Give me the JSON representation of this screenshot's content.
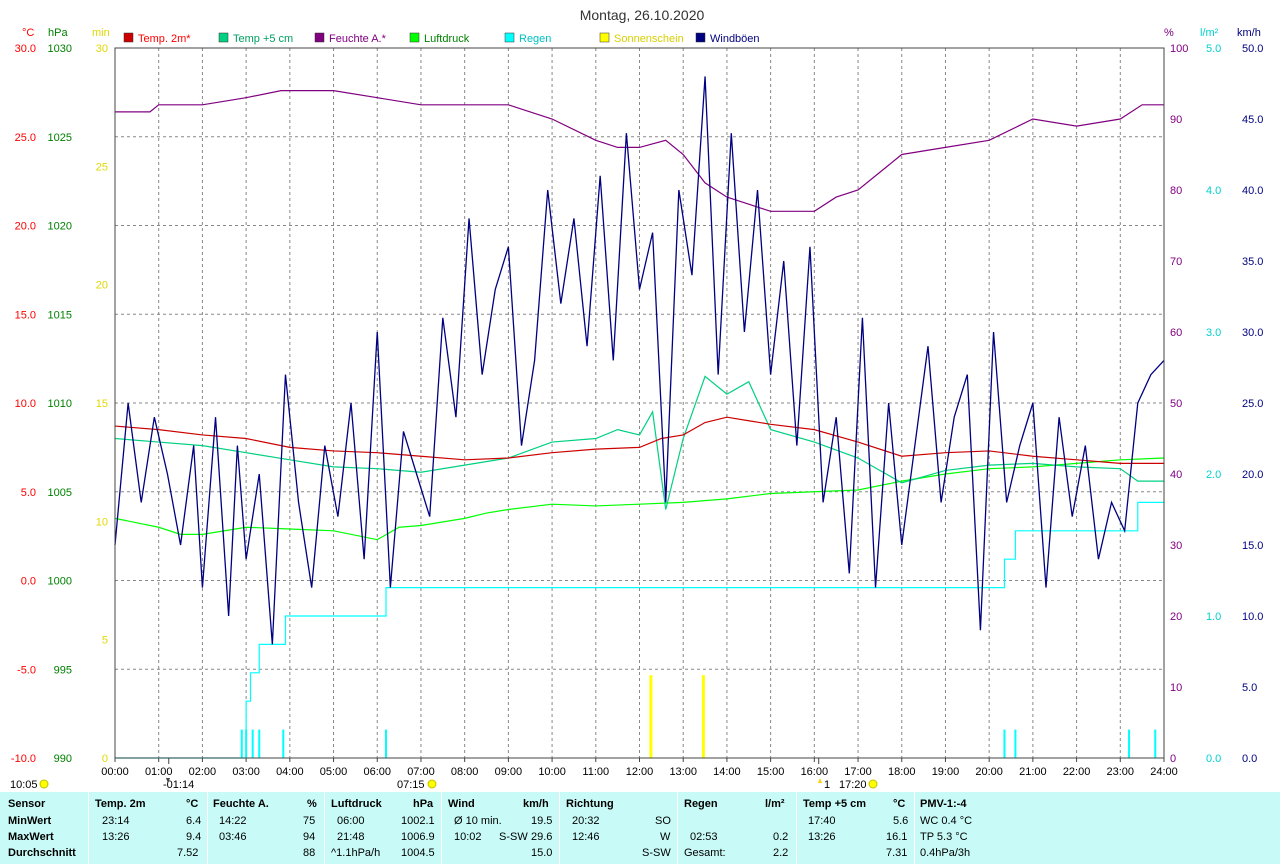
{
  "chart_data": {
    "type": "line",
    "title": "Montag, 26.10.2020",
    "x_ticks": [
      "00:00",
      "01:00",
      "02:00",
      "03:00",
      "04:00",
      "05:00",
      "06:00",
      "07:00",
      "08:00",
      "09:00",
      "10:00",
      "11:00",
      "12:00",
      "13:00",
      "14:00",
      "15:00",
      "16:00",
      "17:00",
      "18:00",
      "19:00",
      "20:00",
      "21:00",
      "22:00",
      "23:00",
      "24:00"
    ],
    "x_range_h": [
      0,
      24
    ],
    "grid": true,
    "legend_position": "top",
    "axes": {
      "temp": {
        "unit": "°C",
        "range": [
          -10,
          30
        ],
        "ticks": [
          "30.0",
          "25.0",
          "20.0",
          "15.0",
          "10.0",
          "5.0",
          "0.0",
          "-5.0",
          "-10.0"
        ],
        "color": "#ff0000"
      },
      "press": {
        "unit": "hPa",
        "range": [
          990,
          1030
        ],
        "ticks": [
          "1030",
          "1025",
          "1020",
          "1015",
          "1010",
          "1005",
          "1000",
          "995",
          "990"
        ],
        "color": "#008000"
      },
      "sun": {
        "unit": "min",
        "range": [
          0,
          30
        ],
        "ticks": [
          "30",
          "25",
          "20",
          "15",
          "10",
          "5",
          "0"
        ],
        "color": "#ffff00"
      },
      "hum": {
        "unit": "%",
        "range": [
          0,
          100
        ],
        "ticks": [
          "100",
          "90",
          "80",
          "70",
          "60",
          "50",
          "40",
          "30",
          "20",
          "10",
          "0"
        ],
        "color": "#800080"
      },
      "rain": {
        "unit": "l/m²",
        "range": [
          0,
          5
        ],
        "ticks": [
          "5.0",
          "4.0",
          "3.0",
          "2.0",
          "1.0",
          "0.0"
        ],
        "color": "#00ffff"
      },
      "wind": {
        "unit": "km/h",
        "range": [
          0,
          50
        ],
        "ticks": [
          "50.0",
          "45.0",
          "40.0",
          "35.0",
          "30.0",
          "25.0",
          "20.0",
          "15.0",
          "10.0",
          "5.0",
          "0.0"
        ],
        "color": "#000080"
      }
    },
    "legend": [
      {
        "name": "Temp. 2m*",
        "color": "#cc0000",
        "text_color": "#ff0000"
      },
      {
        "name": "Temp +5 cm",
        "color": "#00d080",
        "text_color": "#00a060"
      },
      {
        "name": "Feuchte A.*",
        "color": "#800080",
        "text_color": "#800080"
      },
      {
        "name": "Luftdruck",
        "color": "#00ff00",
        "text_color": "#008000"
      },
      {
        "name": "Regen",
        "color": "#00ffff",
        "text_color": "#00c0c0"
      },
      {
        "name": "Sonnenschein",
        "color": "#ffff00",
        "text_color": "#d8d000"
      },
      {
        "name": "Windböen",
        "color": "#000080",
        "text_color": "#000080"
      }
    ],
    "series": [
      {
        "name": "Temp. 2m*",
        "axis": "temp",
        "color": "#cc0000",
        "x": [
          0,
          1,
          2,
          3,
          4,
          5,
          6,
          7,
          8,
          9,
          10,
          11,
          12,
          12.5,
          13,
          13.5,
          14,
          14.5,
          15,
          16,
          17,
          18,
          19,
          20,
          21,
          22,
          23,
          24
        ],
        "y": [
          8.7,
          8.5,
          8.2,
          8.0,
          7.5,
          7.3,
          7.2,
          7.0,
          6.8,
          6.9,
          7.2,
          7.4,
          7.5,
          8.0,
          8.2,
          8.9,
          9.2,
          9.0,
          8.8,
          8.5,
          7.8,
          7.0,
          7.2,
          7.3,
          7.0,
          6.8,
          6.6,
          6.6
        ]
      },
      {
        "name": "Temp +5 cm",
        "axis": "temp",
        "color": "#00d080",
        "x": [
          0,
          1,
          2,
          3,
          4,
          5,
          6,
          7,
          8,
          9,
          10,
          11,
          11.5,
          12,
          12.3,
          12.6,
          13,
          13.5,
          14,
          14.5,
          15,
          16,
          17,
          18,
          19,
          20,
          21,
          22,
          23,
          23.4,
          24
        ],
        "y": [
          8.0,
          7.8,
          7.6,
          7.2,
          6.8,
          6.4,
          6.3,
          6.1,
          6.5,
          6.9,
          7.8,
          8.0,
          8.5,
          8.2,
          9.5,
          4.0,
          8.0,
          11.5,
          10.5,
          11.2,
          8.5,
          7.8,
          6.9,
          5.5,
          6.2,
          6.5,
          6.6,
          6.4,
          6.3,
          5.6,
          5.6
        ]
      },
      {
        "name": "Feuchte A.*",
        "axis": "hum",
        "color": "#800080",
        "x": [
          0,
          0.8,
          1,
          2,
          3,
          3.8,
          4.5,
          5,
          6,
          7,
          8,
          9,
          10,
          11,
          11.5,
          12,
          12.6,
          13,
          13.5,
          14,
          14.5,
          15,
          16,
          16.5,
          17,
          18,
          19,
          20,
          21,
          22,
          23,
          23.5,
          24
        ],
        "y": [
          91,
          91,
          92,
          92,
          93,
          94,
          94,
          94,
          93,
          92,
          92,
          92,
          90,
          87,
          86,
          86,
          87,
          85,
          81,
          79,
          78,
          77,
          77,
          79,
          80,
          85,
          86,
          87,
          90,
          89,
          90,
          92,
          92
        ]
      },
      {
        "name": "Luftdruck",
        "axis": "press",
        "color": "#00ff00",
        "x": [
          0,
          1,
          1.5,
          2,
          3,
          4,
          5,
          6,
          6.5,
          7,
          8,
          8.5,
          9,
          10,
          11,
          12,
          13,
          14,
          15,
          16,
          17,
          18,
          19,
          20,
          21,
          22,
          23,
          24
        ],
        "y": [
          1003.5,
          1003.0,
          1002.6,
          1002.6,
          1003.0,
          1002.9,
          1002.8,
          1002.3,
          1003.0,
          1003.1,
          1003.5,
          1003.8,
          1004.0,
          1004.3,
          1004.2,
          1004.3,
          1004.4,
          1004.6,
          1004.9,
          1005.0,
          1005.1,
          1005.6,
          1006.0,
          1006.3,
          1006.4,
          1006.6,
          1006.8,
          1006.9
        ]
      },
      {
        "name": "Regen",
        "axis": "rain",
        "color": "#00ffff",
        "x": [
          0,
          2.9,
          3.0,
          3.1,
          3.3,
          3.8,
          3.9,
          4.5,
          5,
          6,
          6.2,
          7,
          8,
          9,
          10,
          11,
          12,
          13,
          14,
          15,
          16,
          17,
          18,
          19,
          20,
          20.35,
          20.6,
          21,
          22,
          23,
          23.4,
          24
        ],
        "y": [
          0,
          0,
          0.4,
          0.6,
          0.8,
          0.8,
          1.0,
          1.0,
          1.0,
          1.0,
          1.2,
          1.2,
          1.2,
          1.2,
          1.2,
          1.2,
          1.2,
          1.2,
          1.2,
          1.2,
          1.2,
          1.2,
          1.2,
          1.2,
          1.2,
          1.4,
          1.6,
          1.6,
          1.6,
          1.6,
          1.8,
          1.8
        ]
      },
      {
        "name": "Windböen",
        "axis": "wind",
        "color": "#000080",
        "x": [
          0,
          0.3,
          0.6,
          0.9,
          1.2,
          1.5,
          1.8,
          2.0,
          2.3,
          2.6,
          2.8,
          3.0,
          3.3,
          3.6,
          3.9,
          4.2,
          4.5,
          4.8,
          5.1,
          5.4,
          5.7,
          6.0,
          6.3,
          6.6,
          6.9,
          7.2,
          7.5,
          7.8,
          8.1,
          8.4,
          8.7,
          9.0,
          9.3,
          9.6,
          9.9,
          10.2,
          10.5,
          10.8,
          11.1,
          11.4,
          11.7,
          12.0,
          12.3,
          12.6,
          12.9,
          13.2,
          13.5,
          13.8,
          14.1,
          14.4,
          14.7,
          15.0,
          15.3,
          15.6,
          15.9,
          16.2,
          16.5,
          16.8,
          17.1,
          17.4,
          17.7,
          18.0,
          18.3,
          18.6,
          18.9,
          19.2,
          19.5,
          19.8,
          20.1,
          20.4,
          20.7,
          21.0,
          21.3,
          21.6,
          21.9,
          22.2,
          22.5,
          22.8,
          23.1,
          23.4,
          23.7,
          24.0
        ],
        "y": [
          15,
          25,
          18,
          24,
          20,
          15,
          22,
          12,
          24,
          10,
          22,
          14,
          20,
          8,
          27,
          18,
          12,
          22,
          17,
          25,
          14,
          30,
          12,
          23,
          20,
          17,
          31,
          24,
          38,
          27,
          33,
          36,
          22,
          28,
          40,
          32,
          38,
          29,
          41,
          28,
          44,
          33,
          37,
          18,
          40,
          34,
          48,
          27,
          44,
          30,
          40,
          27,
          35,
          22,
          36,
          18,
          24,
          13,
          31,
          12,
          25,
          15,
          22,
          29,
          18,
          24,
          27,
          9,
          30,
          18,
          22,
          25,
          12,
          24,
          17,
          22,
          14,
          18,
          16,
          25,
          27,
          28
        ]
      }
    ],
    "sun_bars": [
      {
        "x": 12.25,
        "value": 3.5
      },
      {
        "x": 13.45,
        "value": 3.5
      }
    ],
    "rain_bars": [
      {
        "x": 2.9,
        "value": 0.2
      },
      {
        "x": 3.0,
        "value": 0.2
      },
      {
        "x": 3.15,
        "value": 0.2
      },
      {
        "x": 3.3,
        "value": 0.2
      },
      {
        "x": 3.85,
        "value": 0.2
      },
      {
        "x": 6.2,
        "value": 0.2
      },
      {
        "x": 20.35,
        "value": 0.2
      },
      {
        "x": 20.6,
        "value": 0.2
      },
      {
        "x": 23.2,
        "value": 0.2
      },
      {
        "x": 23.8,
        "value": 0.2
      }
    ],
    "annotations": {
      "sunrise": "07:15",
      "sunset": "17:20",
      "time_left": "10:05",
      "marker_1": "-01:14",
      "marker_2": "1"
    }
  },
  "summary": {
    "headers": {
      "sensor": "Sensor",
      "temp2m": "Temp. 2m",
      "temp2m_unit": "°C",
      "hum": "Feuchte A.",
      "hum_unit": "%",
      "press": "Luftdruck",
      "press_unit": "hPa",
      "wind": "Wind",
      "wind_unit": "km/h",
      "dir": "Richtung",
      "rain": "Regen",
      "rain_unit": "l/m²",
      "temp5": "Temp +5 cm",
      "temp5_unit": "°C",
      "pmv": "PMV-1:-4"
    },
    "min": {
      "label": "MinWert",
      "temp2m_time": "23:14",
      "temp2m_val": "6.4",
      "hum_time": "14:22",
      "hum_val": "75",
      "press_time": "06:00",
      "press_val": "1002.1",
      "wind_label": "Ø 10 min.",
      "wind_val": "19.5",
      "dir_time": "20:32",
      "dir_val": "SO",
      "temp5_time": "17:40",
      "temp5_val": "5.6",
      "pmv": "WC 0.4 °C"
    },
    "max": {
      "label": "MaxWert",
      "temp2m_time": "13:26",
      "temp2m_val": "9.4",
      "hum_time": "03:46",
      "hum_val": "94",
      "press_time": "21:48",
      "press_val": "1006.9",
      "wind_time": "10:02",
      "wind_dir": "S-SW",
      "wind_val": "29.6",
      "dir_time": "12:46",
      "dir_val": "W",
      "rain_time": "02:53",
      "rain_val": "0.2",
      "temp5_time": "13:26",
      "temp5_val": "16.1",
      "pmv": "TP 5.3 °C"
    },
    "avg": {
      "label": "Durchschnitt",
      "temp2m_val": "7.52",
      "hum_val": "88",
      "press_trend": "^1.1hPa/h",
      "press_val": "1004.5",
      "wind_val": "15.0",
      "dir_val": "S-SW",
      "rain_label": "Gesamt:",
      "rain_val": "2.2",
      "temp5_val": "7.31",
      "pmv": "0.4hPa/3h"
    }
  }
}
